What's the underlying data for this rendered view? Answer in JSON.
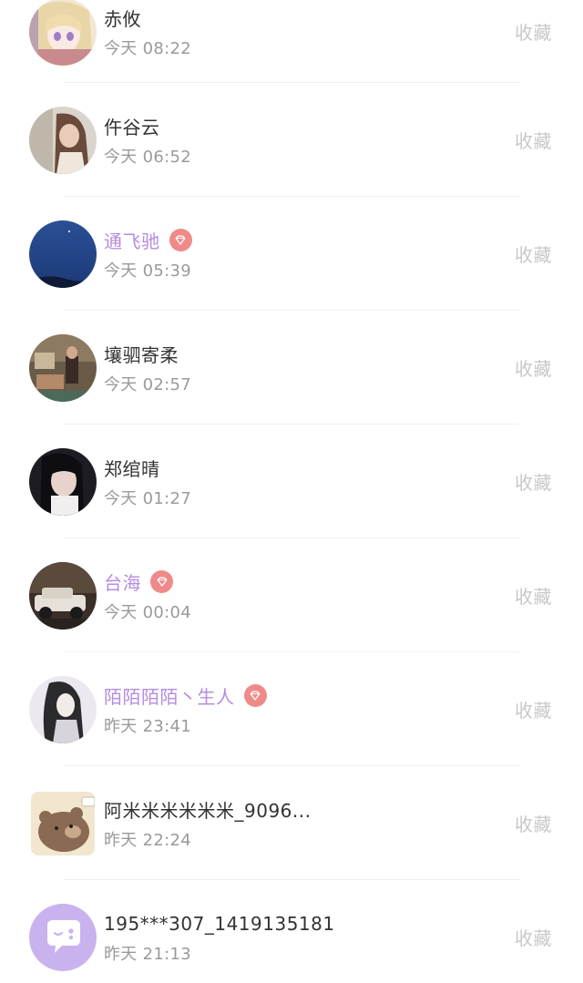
{
  "fav_label": "收藏",
  "vip_color": "#b58cdf",
  "badge_color": "#f08a8a",
  "rows": [
    {
      "name": "赤攸",
      "time": "今天 08:22",
      "vip": false,
      "avatar": "anime-girl"
    },
    {
      "name": "仵谷云",
      "time": "今天 06:52",
      "vip": false,
      "avatar": "woman-photo"
    },
    {
      "name": "通飞驰",
      "time": "今天 05:39",
      "vip": true,
      "avatar": "night-sky"
    },
    {
      "name": "壤驷寄柔",
      "time": "今天 02:57",
      "vip": false,
      "avatar": "room-photo"
    },
    {
      "name": "郑绾晴",
      "time": "今天 01:27",
      "vip": false,
      "avatar": "girl-photo"
    },
    {
      "name": "台海",
      "time": "今天 00:04",
      "vip": true,
      "avatar": "car-photo"
    },
    {
      "name": "陌陌陌陌丶生人",
      "time": "昨天 23:41",
      "vip": true,
      "avatar": "sketch-girl"
    },
    {
      "name": "阿米米米米米米_9096...",
      "time": "昨天 22:24",
      "vip": false,
      "avatar": "cartoon-bear"
    },
    {
      "name": "195***307_1419135181",
      "time": "昨天 21:13",
      "vip": false,
      "avatar": "default-chat-bubble"
    }
  ]
}
